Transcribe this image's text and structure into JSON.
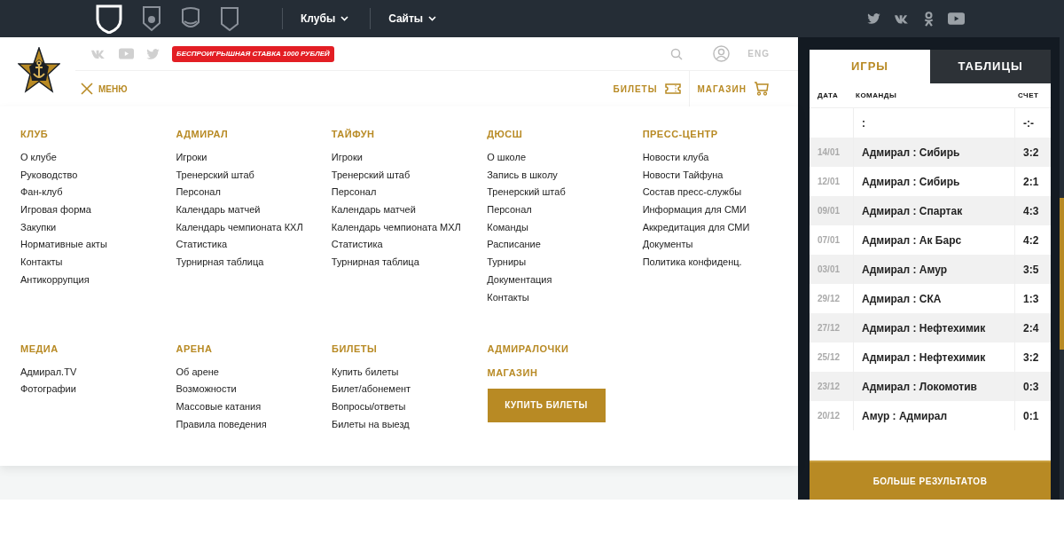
{
  "top_bar": {
    "nav": [
      {
        "label": "Клубы"
      },
      {
        "label": "Сайты"
      }
    ]
  },
  "header": {
    "promo": "БЕСПРОИГРЫШНАЯ СТАВКА 1000 РУБЛЕЙ",
    "language": "ENG",
    "menu_label": "МЕНЮ",
    "links": [
      {
        "label": "БИЛЕТЫ",
        "kind": "ticket"
      },
      {
        "label": "МАГАЗИН",
        "kind": "cart"
      }
    ]
  },
  "menu": {
    "rows": [
      [
        {
          "kind": "list",
          "title": "КЛУБ",
          "items": [
            "О клубе",
            "Руководство",
            "Фан-клуб",
            "Игровая форма",
            "Закупки",
            "Нормативные акты",
            "Контакты",
            "Антикоррупция"
          ]
        },
        {
          "kind": "list",
          "title": "АДМИРАЛ",
          "items": [
            "Игроки",
            "Тренерский штаб",
            "Персонал",
            "Календарь матчей",
            "Календарь чемпионата КХЛ",
            "Статистика",
            "Турнирная таблица"
          ]
        },
        {
          "kind": "list",
          "title": "ТАЙФУН",
          "items": [
            "Игроки",
            "Тренерский штаб",
            "Персонал",
            "Календарь матчей",
            "Календарь чемпионата МХЛ",
            "Статистика",
            "Турнирная таблица"
          ]
        },
        {
          "kind": "list",
          "title": "ДЮСШ",
          "items": [
            "О школе",
            "Запись в школу",
            "Тренерский штаб",
            "Персонал",
            "Команды",
            "Расписание",
            "Турниры",
            "Документация",
            "Контакты"
          ]
        },
        {
          "kind": "list",
          "title": "ПРЕСС-ЦЕНТР",
          "items": [
            "Новости клуба",
            "Новости Тайфуна",
            "Состав пресс-службы",
            "Информация для СМИ",
            "Аккредитация для СМИ",
            "Документы",
            "Политика конфиденц."
          ]
        }
      ],
      [
        {
          "kind": "list",
          "title": "МЕДИА",
          "items": [
            "Адмирал.TV",
            "Фотографии"
          ]
        },
        {
          "kind": "list",
          "title": "АРЕНА",
          "items": [
            "Об арене",
            "Возможности",
            "Массовые катания",
            "Правила поведения"
          ]
        },
        {
          "kind": "list",
          "title": "БИЛЕТЫ",
          "items": [
            "Купить билеты",
            "Билет/абонемент",
            "Вопросы/ответы",
            "Билеты на выезд"
          ]
        },
        {
          "kind": "stack",
          "headings": [
            "АДМИРАЛОЧКИ",
            "МАГАЗИН"
          ],
          "button": "КУПИТЬ БИЛЕТЫ"
        }
      ]
    ]
  },
  "sidebar": {
    "tabs": [
      {
        "label": "ИГРЫ",
        "selected": true
      },
      {
        "label": "ТАБЛИЦЫ",
        "selected": false
      }
    ],
    "columns": [
      "ДАТА",
      "КОМАНДЫ",
      "СЧЕТ"
    ],
    "rows": [
      {
        "teams": ":",
        "score": "-:-"
      },
      {
        "date": "14/01",
        "teams": "Адмирал : Сибирь",
        "score": "3:2"
      },
      {
        "date": "12/01",
        "teams": "Адмирал : Сибирь",
        "score": "2:1"
      },
      {
        "date": "09/01",
        "teams": "Адмирал : Спартак",
        "score": "4:3"
      },
      {
        "date": "07/01",
        "teams": "Адмирал : Ак Барс",
        "score": "4:2"
      },
      {
        "date": "03/01",
        "teams": "Адмирал : Амур",
        "score": "3:5"
      },
      {
        "date": "29/12",
        "teams": "Адмирал : СКА",
        "score": "1:3"
      },
      {
        "date": "27/12",
        "teams": "Адмирал : Нефтехимик",
        "score": "2:4"
      },
      {
        "date": "25/12",
        "teams": "Адмирал : Нефтехимик",
        "score": "3:2"
      },
      {
        "date": "23/12",
        "teams": "Адмирал : Локомотив",
        "score": "0:3"
      },
      {
        "date": "20/12",
        "teams": "Амур : Адмирал",
        "score": "0:1"
      }
    ],
    "more_button": "БОЛЬШЕ РЕЗУЛЬТАТОВ"
  }
}
